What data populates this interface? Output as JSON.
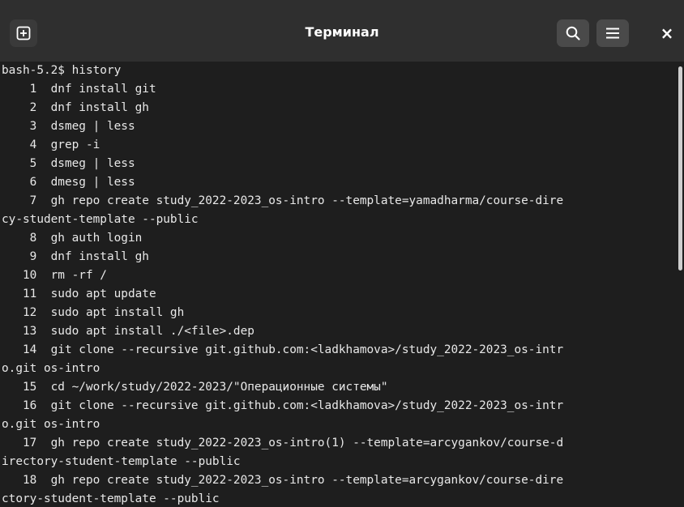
{
  "window": {
    "title": "Терминал"
  },
  "titlebar": {
    "new_tab_icon": "plus-square-icon",
    "search_icon": "search-icon",
    "menu_icon": "hamburger-menu-icon",
    "close_icon": "close-icon",
    "close_glyph": "×"
  },
  "terminal": {
    "lines": [
      "bash-5.2$ history",
      "    1  dnf install git",
      "    2  dnf install gh",
      "    3  dsmeg | less",
      "    4  grep -i",
      "    5  dsmeg | less",
      "    6  dmesg | less",
      "    7  gh repo create study_2022-2023_os-intro --template=yamadharma/course-dire",
      "cy-student-template --public",
      "    8  gh auth login",
      "    9  dnf install gh",
      "   10  rm -rf /",
      "   11  sudo apt update",
      "   12  sudo apt install gh",
      "   13  sudo apt install ./<file>.dep",
      "   14  git clone --recursive git.github.com:<ladkhamova>/study_2022-2023_os-intr",
      "o.git os-intro",
      "   15  cd ~/work/study/2022-2023/\"Операционные системы\"",
      "   16  git clone --recursive git.github.com:<ladkhamova>/study_2022-2023_os-intr",
      "o.git os-intro",
      "   17  gh repo create study_2022-2023_os-intro(1) --template=arcygankov/course-d",
      "irectory-student-template --public",
      "   18  gh repo create study_2022-2023_os-intro --template=arcygankov/course-dire",
      "ctory-student-template --public"
    ]
  },
  "colors": {
    "background": "#1e1e1e",
    "titlebar": "#2f2f2f",
    "text": "#e8e8e8"
  }
}
